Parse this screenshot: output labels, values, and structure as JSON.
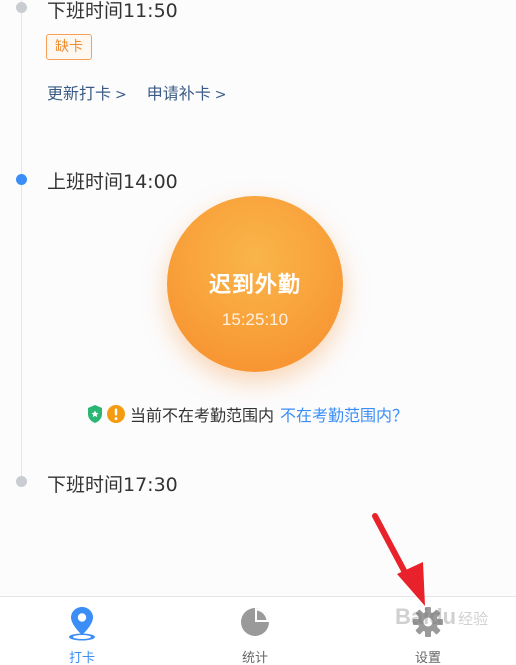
{
  "timeline": {
    "entries": [
      {
        "label": "下班时间11:50",
        "status": "grey"
      },
      {
        "label": "上班时间14:00",
        "status": "active"
      },
      {
        "label": "下班时间17:30",
        "status": "grey"
      }
    ],
    "badge": "缺卡",
    "links": {
      "update": "更新打卡",
      "apply": "申请补卡",
      "chevron": ">"
    }
  },
  "punch": {
    "title": "迟到外勤",
    "time": "15:25:10"
  },
  "range": {
    "text": "当前不在考勤范围内",
    "link": "不在考勤范围内？"
  },
  "tabs": [
    {
      "label": "打卡",
      "icon": "location-pin-icon",
      "active": true
    },
    {
      "label": "统计",
      "icon": "pie-chart-icon",
      "active": false
    },
    {
      "label": "设置",
      "icon": "gear-icon",
      "active": false
    }
  ],
  "watermark": {
    "brand": "Baidu",
    "sub": "经验"
  },
  "colors": {
    "accent": "#3a8ef6",
    "orange": "#f68c2c",
    "badge": "#f08a2e",
    "green_shield": "#2bb673",
    "warning": "#f39c12",
    "arrow": "#e8212a"
  }
}
